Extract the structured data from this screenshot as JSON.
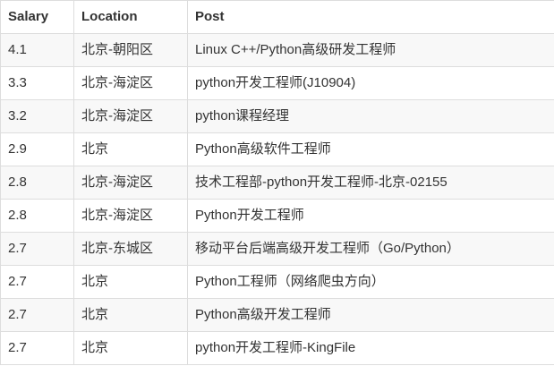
{
  "table": {
    "headers": [
      "Salary",
      "Location",
      "Post"
    ],
    "rows": [
      [
        "4.1",
        "北京-朝阳区",
        "Linux C++/Python高级研发工程师"
      ],
      [
        "3.3",
        "北京-海淀区",
        "python开发工程师(J10904)"
      ],
      [
        "3.2",
        "北京-海淀区",
        "python课程经理"
      ],
      [
        "2.9",
        "北京",
        "Python高级软件工程师"
      ],
      [
        "2.8",
        "北京-海淀区",
        "技术工程部-python开发工程师-北京-02155"
      ],
      [
        "2.8",
        "北京-海淀区",
        "Python开发工程师"
      ],
      [
        "2.7",
        "北京-东城区",
        "移动平台后端高级开发工程师（Go/Python）"
      ],
      [
        "2.7",
        "北京",
        "Python工程师（网络爬虫方向）"
      ],
      [
        "2.7",
        "北京",
        "Python高级开发工程师"
      ],
      [
        "2.7",
        "北京",
        "python开发工程师-KingFile"
      ]
    ]
  }
}
